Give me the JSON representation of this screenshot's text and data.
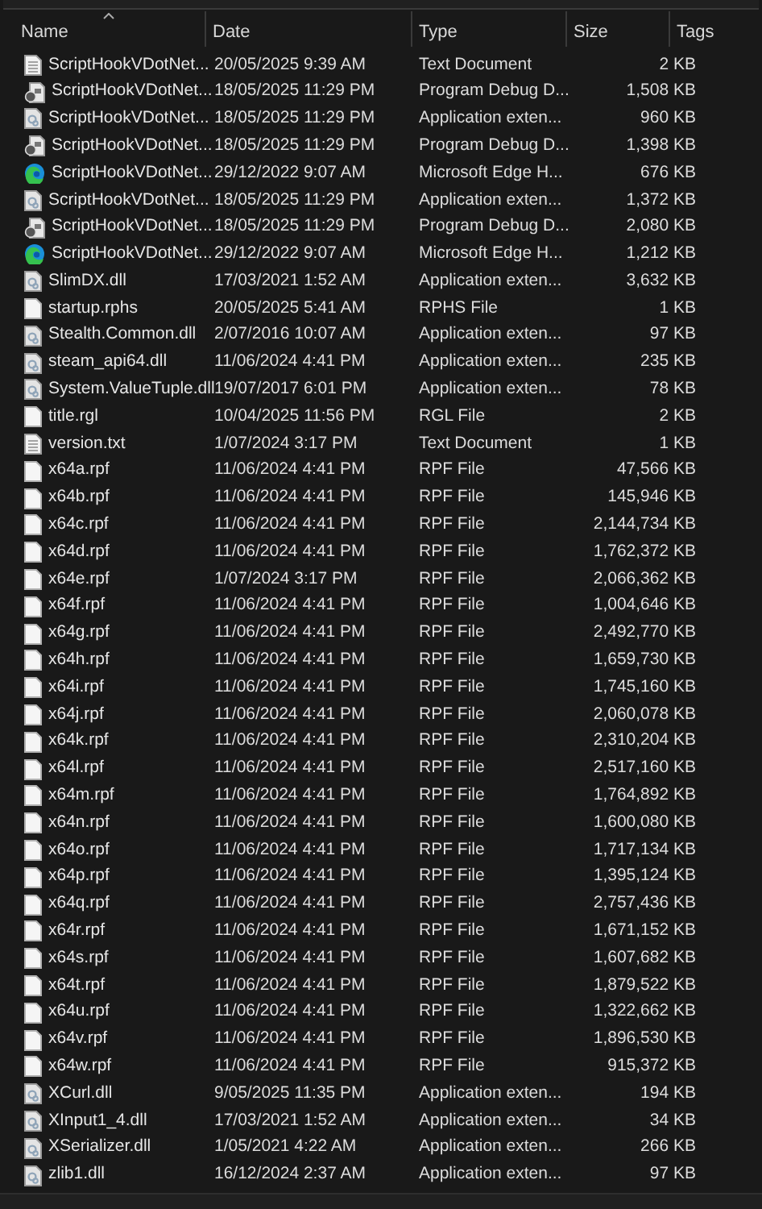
{
  "columns": [
    {
      "label": "Name",
      "sorted": true
    },
    {
      "label": "Date",
      "sorted": false
    },
    {
      "label": "Type",
      "sorted": false
    },
    {
      "label": "Size",
      "sorted": false
    },
    {
      "label": "Tags",
      "sorted": false
    }
  ],
  "rows": [
    {
      "kind": "text",
      "name": "ScriptHookVDotNet...",
      "date": "20/05/2025 9:39 AM",
      "type": "Text Document",
      "size": "2 KB"
    },
    {
      "kind": "debug",
      "name": "ScriptHookVDotNet...",
      "date": "18/05/2025 11:29 PM",
      "type": "Program Debug D...",
      "size": "1,508 KB"
    },
    {
      "kind": "dll",
      "name": "ScriptHookVDotNet...",
      "date": "18/05/2025 11:29 PM",
      "type": "Application exten...",
      "size": "960 KB"
    },
    {
      "kind": "debug",
      "name": "ScriptHookVDotNet...",
      "date": "18/05/2025 11:29 PM",
      "type": "Program Debug D...",
      "size": "1,398 KB"
    },
    {
      "kind": "edge",
      "name": "ScriptHookVDotNet...",
      "date": "29/12/2022 9:07 AM",
      "type": "Microsoft Edge H...",
      "size": "676 KB"
    },
    {
      "kind": "dll",
      "name": "ScriptHookVDotNet...",
      "date": "18/05/2025 11:29 PM",
      "type": "Application exten...",
      "size": "1,372 KB"
    },
    {
      "kind": "debug",
      "name": "ScriptHookVDotNet...",
      "date": "18/05/2025 11:29 PM",
      "type": "Program Debug D...",
      "size": "2,080 KB"
    },
    {
      "kind": "edge",
      "name": "ScriptHookVDotNet...",
      "date": "29/12/2022 9:07 AM",
      "type": "Microsoft Edge H...",
      "size": "1,212 KB"
    },
    {
      "kind": "dll",
      "name": "SlimDX.dll",
      "date": "17/03/2021 1:52 AM",
      "type": "Application exten...",
      "size": "3,632 KB"
    },
    {
      "kind": "blank",
      "name": "startup.rphs",
      "date": "20/05/2025 5:41 AM",
      "type": "RPHS File",
      "size": "1 KB"
    },
    {
      "kind": "dll",
      "name": "Stealth.Common.dll",
      "date": "2/07/2016 10:07 AM",
      "type": "Application exten...",
      "size": "97 KB"
    },
    {
      "kind": "dll",
      "name": "steam_api64.dll",
      "date": "11/06/2024 4:41 PM",
      "type": "Application exten...",
      "size": "235 KB"
    },
    {
      "kind": "dll",
      "name": "System.ValueTuple.dll",
      "date": "19/07/2017 6:01 PM",
      "type": "Application exten...",
      "size": "78 KB"
    },
    {
      "kind": "blank",
      "name": "title.rgl",
      "date": "10/04/2025 11:56 PM",
      "type": "RGL File",
      "size": "2 KB"
    },
    {
      "kind": "text",
      "name": "version.txt",
      "date": "1/07/2024 3:17 PM",
      "type": "Text Document",
      "size": "1 KB"
    },
    {
      "kind": "blank",
      "name": "x64a.rpf",
      "date": "11/06/2024 4:41 PM",
      "type": "RPF File",
      "size": "47,566 KB"
    },
    {
      "kind": "blank",
      "name": "x64b.rpf",
      "date": "11/06/2024 4:41 PM",
      "type": "RPF File",
      "size": "145,946 KB"
    },
    {
      "kind": "blank",
      "name": "x64c.rpf",
      "date": "11/06/2024 4:41 PM",
      "type": "RPF File",
      "size": "2,144,734 KB"
    },
    {
      "kind": "blank",
      "name": "x64d.rpf",
      "date": "11/06/2024 4:41 PM",
      "type": "RPF File",
      "size": "1,762,372 KB"
    },
    {
      "kind": "blank",
      "name": "x64e.rpf",
      "date": "1/07/2024 3:17 PM",
      "type": "RPF File",
      "size": "2,066,362 KB"
    },
    {
      "kind": "blank",
      "name": "x64f.rpf",
      "date": "11/06/2024 4:41 PM",
      "type": "RPF File",
      "size": "1,004,646 KB"
    },
    {
      "kind": "blank",
      "name": "x64g.rpf",
      "date": "11/06/2024 4:41 PM",
      "type": "RPF File",
      "size": "2,492,770 KB"
    },
    {
      "kind": "blank",
      "name": "x64h.rpf",
      "date": "11/06/2024 4:41 PM",
      "type": "RPF File",
      "size": "1,659,730 KB"
    },
    {
      "kind": "blank",
      "name": "x64i.rpf",
      "date": "11/06/2024 4:41 PM",
      "type": "RPF File",
      "size": "1,745,160 KB"
    },
    {
      "kind": "blank",
      "name": "x64j.rpf",
      "date": "11/06/2024 4:41 PM",
      "type": "RPF File",
      "size": "2,060,078 KB"
    },
    {
      "kind": "blank",
      "name": "x64k.rpf",
      "date": "11/06/2024 4:41 PM",
      "type": "RPF File",
      "size": "2,310,204 KB"
    },
    {
      "kind": "blank",
      "name": "x64l.rpf",
      "date": "11/06/2024 4:41 PM",
      "type": "RPF File",
      "size": "2,517,160 KB"
    },
    {
      "kind": "blank",
      "name": "x64m.rpf",
      "date": "11/06/2024 4:41 PM",
      "type": "RPF File",
      "size": "1,764,892 KB"
    },
    {
      "kind": "blank",
      "name": "x64n.rpf",
      "date": "11/06/2024 4:41 PM",
      "type": "RPF File",
      "size": "1,600,080 KB"
    },
    {
      "kind": "blank",
      "name": "x64o.rpf",
      "date": "11/06/2024 4:41 PM",
      "type": "RPF File",
      "size": "1,717,134 KB"
    },
    {
      "kind": "blank",
      "name": "x64p.rpf",
      "date": "11/06/2024 4:41 PM",
      "type": "RPF File",
      "size": "1,395,124 KB"
    },
    {
      "kind": "blank",
      "name": "x64q.rpf",
      "date": "11/06/2024 4:41 PM",
      "type": "RPF File",
      "size": "2,757,436 KB"
    },
    {
      "kind": "blank",
      "name": "x64r.rpf",
      "date": "11/06/2024 4:41 PM",
      "type": "RPF File",
      "size": "1,671,152 KB"
    },
    {
      "kind": "blank",
      "name": "x64s.rpf",
      "date": "11/06/2024 4:41 PM",
      "type": "RPF File",
      "size": "1,607,682 KB"
    },
    {
      "kind": "blank",
      "name": "x64t.rpf",
      "date": "11/06/2024 4:41 PM",
      "type": "RPF File",
      "size": "1,879,522 KB"
    },
    {
      "kind": "blank",
      "name": "x64u.rpf",
      "date": "11/06/2024 4:41 PM",
      "type": "RPF File",
      "size": "1,322,662 KB"
    },
    {
      "kind": "blank",
      "name": "x64v.rpf",
      "date": "11/06/2024 4:41 PM",
      "type": "RPF File",
      "size": "1,896,530 KB"
    },
    {
      "kind": "blank",
      "name": "x64w.rpf",
      "date": "11/06/2024 4:41 PM",
      "type": "RPF File",
      "size": "915,372 KB"
    },
    {
      "kind": "dll",
      "name": "XCurl.dll",
      "date": "9/05/2025 11:35 PM",
      "type": "Application exten...",
      "size": "194 KB"
    },
    {
      "kind": "dll",
      "name": "XInput1_4.dll",
      "date": "17/03/2021 1:52 AM",
      "type": "Application exten...",
      "size": "34 KB"
    },
    {
      "kind": "dll",
      "name": "XSerializer.dll",
      "date": "1/05/2021 4:22 AM",
      "type": "Application exten...",
      "size": "266 KB"
    },
    {
      "kind": "dll",
      "name": "zlib1.dll",
      "date": "16/12/2024 2:37 AM",
      "type": "Application exten...",
      "size": "97 KB"
    }
  ]
}
